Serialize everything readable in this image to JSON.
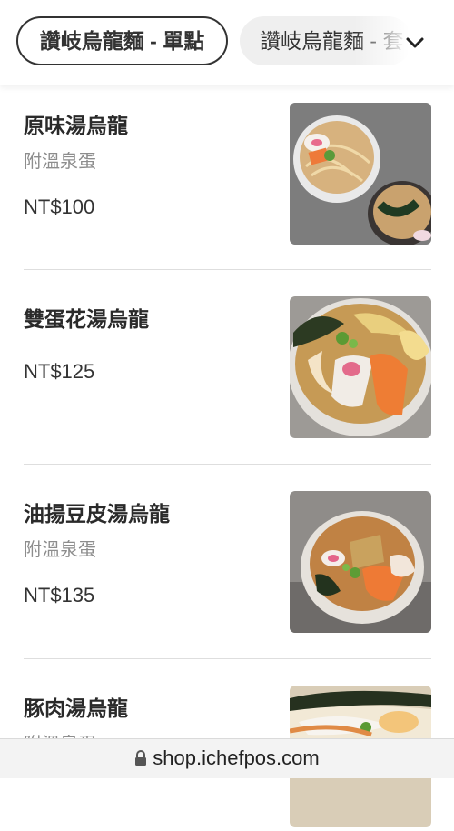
{
  "category_tabs": {
    "active": "讚岐烏龍麵 - 單點",
    "next": "讚岐烏龍麵 - 套",
    "expand_icon": "chevron-down-icon"
  },
  "menu": {
    "items": [
      {
        "name": "原味湯烏龍",
        "note": "附溫泉蛋",
        "price": "NT$100",
        "image": "udon-with-fish-cake-photo"
      },
      {
        "name": "雙蛋花湯烏龍",
        "note": "",
        "price": "NT$125",
        "image": "egg-drop-udon-photo"
      },
      {
        "name": "油揚豆皮湯烏龍",
        "note": "附溫泉蛋",
        "price": "NT$135",
        "image": "fried-tofu-skin-udon-photo"
      },
      {
        "name": "豚肉湯烏龍",
        "note": "附溫泉蛋",
        "price": "",
        "image": "pork-udon-photo"
      }
    ]
  },
  "browser": {
    "url": "shop.ichefpos.com",
    "lock_icon": "lock-icon"
  }
}
